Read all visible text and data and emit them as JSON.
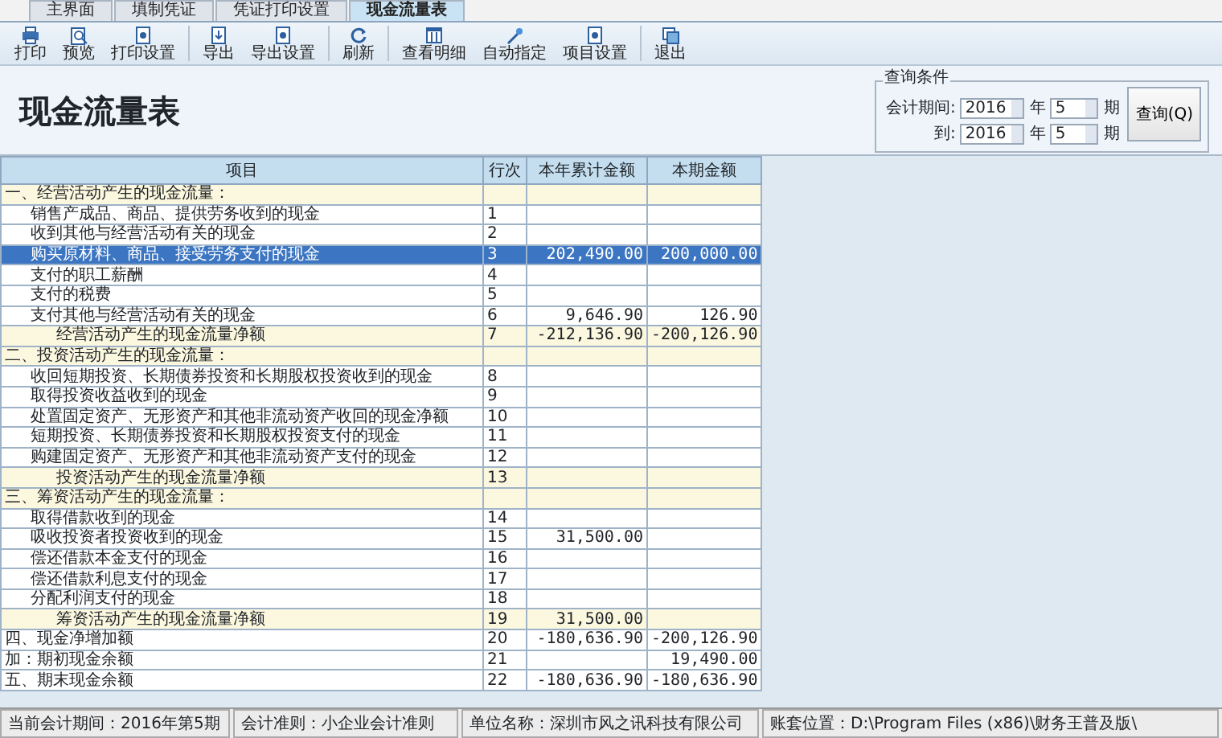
{
  "tabs": [
    {
      "label": "主界面",
      "selected": false
    },
    {
      "label": "填制凭证",
      "selected": false
    },
    {
      "label": "凭证打印设置",
      "selected": false
    },
    {
      "label": "现金流量表",
      "selected": true
    }
  ],
  "toolbar": [
    {
      "kind": "button",
      "label": "打印"
    },
    {
      "kind": "button",
      "label": "预览"
    },
    {
      "kind": "button",
      "label": "打印设置"
    },
    {
      "kind": "sep"
    },
    {
      "kind": "button",
      "label": "导出"
    },
    {
      "kind": "button",
      "label": "导出设置"
    },
    {
      "kind": "sep"
    },
    {
      "kind": "button",
      "label": "刷新"
    },
    {
      "kind": "sep"
    },
    {
      "kind": "button",
      "label": "查看明细"
    },
    {
      "kind": "button",
      "label": "自动指定"
    },
    {
      "kind": "button",
      "label": "项目设置"
    },
    {
      "kind": "sep"
    },
    {
      "kind": "button",
      "label": "退出"
    }
  ],
  "title": "现金流量表",
  "query": {
    "legend": "查询条件",
    "rows": [
      {
        "label": "会计期间:",
        "year": "2016",
        "year_unit": "年",
        "period": "5",
        "period_unit": "期"
      },
      {
        "label": "到:",
        "year": "2016",
        "year_unit": "年",
        "period": "5",
        "period_unit": "期"
      }
    ],
    "button": "查询(Q)"
  },
  "table": {
    "columns": [
      "项目",
      "行次",
      "本年累计金额",
      "本期金额"
    ],
    "rows": [
      {
        "kind": "section",
        "item": "一、经营活动产生的现金流量：",
        "line": "",
        "ytd": "",
        "period": "",
        "selected": false
      },
      {
        "kind": "item",
        "item": "销售产成品、商品、提供劳务收到的现金",
        "line": "1",
        "ytd": "",
        "period": "",
        "selected": false
      },
      {
        "kind": "item",
        "item": "收到其他与经营活动有关的现金",
        "line": "2",
        "ytd": "",
        "period": "",
        "selected": false
      },
      {
        "kind": "item",
        "item": "购买原材料、商品、接受劳务支付的现金",
        "line": "3",
        "ytd": "202,490.00",
        "period": "200,000.00",
        "selected": true
      },
      {
        "kind": "item",
        "item": "支付的职工薪酬",
        "line": "4",
        "ytd": "",
        "period": "",
        "selected": false
      },
      {
        "kind": "item",
        "item": "支付的税费",
        "line": "5",
        "ytd": "",
        "period": "",
        "selected": false
      },
      {
        "kind": "item",
        "item": "支付其他与经营活动有关的现金",
        "line": "6",
        "ytd": "9,646.90",
        "period": "126.90",
        "selected": false
      },
      {
        "kind": "subtotal",
        "item": "经营活动产生的现金流量净额",
        "line": "7",
        "ytd": "-212,136.90",
        "period": "-200,126.90",
        "selected": false
      },
      {
        "kind": "section",
        "item": "二、投资活动产生的现金流量：",
        "line": "",
        "ytd": "",
        "period": "",
        "selected": false
      },
      {
        "kind": "item",
        "item": "收回短期投资、长期债券投资和长期股权投资收到的现金",
        "line": "8",
        "ytd": "",
        "period": "",
        "selected": false
      },
      {
        "kind": "item",
        "item": "取得投资收益收到的现金",
        "line": "9",
        "ytd": "",
        "period": "",
        "selected": false
      },
      {
        "kind": "item",
        "item": "处置固定资产、无形资产和其他非流动资产收回的现金净额",
        "line": "10",
        "ytd": "",
        "period": "",
        "selected": false
      },
      {
        "kind": "item",
        "item": "短期投资、长期债券投资和长期股权投资支付的现金",
        "line": "11",
        "ytd": "",
        "period": "",
        "selected": false
      },
      {
        "kind": "item",
        "item": "购建固定资产、无形资产和其他非流动资产支付的现金",
        "line": "12",
        "ytd": "",
        "period": "",
        "selected": false
      },
      {
        "kind": "subtotal",
        "item": "投资活动产生的现金流量净额",
        "line": "13",
        "ytd": "",
        "period": "",
        "selected": false
      },
      {
        "kind": "section",
        "item": "三、筹资活动产生的现金流量：",
        "line": "",
        "ytd": "",
        "period": "",
        "selected": false
      },
      {
        "kind": "item",
        "item": "取得借款收到的现金",
        "line": "14",
        "ytd": "",
        "period": "",
        "selected": false
      },
      {
        "kind": "item",
        "item": "吸收投资者投资收到的现金",
        "line": "15",
        "ytd": "31,500.00",
        "period": "",
        "selected": false
      },
      {
        "kind": "item",
        "item": "偿还借款本金支付的现金",
        "line": "16",
        "ytd": "",
        "period": "",
        "selected": false
      },
      {
        "kind": "item",
        "item": "偿还借款利息支付的现金",
        "line": "17",
        "ytd": "",
        "period": "",
        "selected": false
      },
      {
        "kind": "item",
        "item": "分配利润支付的现金",
        "line": "18",
        "ytd": "",
        "period": "",
        "selected": false
      },
      {
        "kind": "subtotal",
        "item": "筹资活动产生的现金流量净额",
        "line": "19",
        "ytd": "31,500.00",
        "period": "",
        "selected": false
      },
      {
        "kind": "total",
        "item": "四、现金净增加额",
        "line": "20",
        "ytd": "-180,636.90",
        "period": "-200,126.90",
        "selected": false
      },
      {
        "kind": "total",
        "item": "加：期初现金余额",
        "line": "21",
        "ytd": "",
        "period": "19,490.00",
        "selected": false
      },
      {
        "kind": "total",
        "item": "五、期末现金余额",
        "line": "22",
        "ytd": "-180,636.90",
        "period": "-180,636.90",
        "selected": false
      }
    ]
  },
  "status_bar": [
    "当前会计期间：2016年第5期",
    "会计准则：小企业会计准则",
    "单位名称：深圳市风之讯科技有限公司",
    "账套位置：D:\\Program Files (x86)\\财务王普及版\\"
  ]
}
